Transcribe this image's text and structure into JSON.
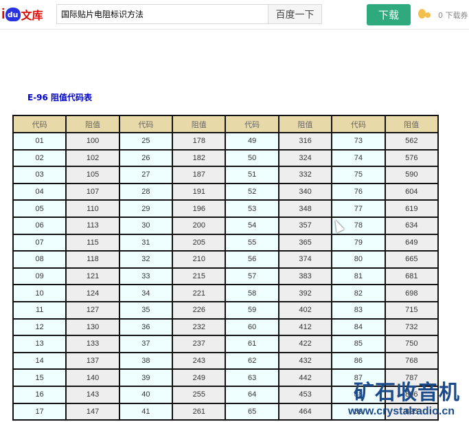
{
  "header": {
    "logo": "文库",
    "logo_du": "du",
    "logo_i": "i",
    "search_value": "国际贴片电阻标识方法",
    "search_button": "百度一下",
    "download_button": "下载",
    "vouchers": "0 下载券"
  },
  "title": "E-96 阻值代码表",
  "table": {
    "headers": [
      "代码",
      "阻值",
      "代码",
      "阻值",
      "代码",
      "阻值",
      "代码",
      "阻值"
    ],
    "rows": [
      [
        "01",
        "100",
        "25",
        "178",
        "49",
        "316",
        "73",
        "562"
      ],
      [
        "02",
        "102",
        "26",
        "182",
        "50",
        "324",
        "74",
        "576"
      ],
      [
        "03",
        "105",
        "27",
        "187",
        "51",
        "332",
        "75",
        "590"
      ],
      [
        "04",
        "107",
        "28",
        "191",
        "52",
        "340",
        "76",
        "604"
      ],
      [
        "05",
        "110",
        "29",
        "196",
        "53",
        "348",
        "77",
        "619"
      ],
      [
        "06",
        "113",
        "30",
        "200",
        "54",
        "357",
        "78",
        "634"
      ],
      [
        "07",
        "115",
        "31",
        "205",
        "55",
        "365",
        "79",
        "649"
      ],
      [
        "08",
        "118",
        "32",
        "210",
        "56",
        "374",
        "80",
        "665"
      ],
      [
        "09",
        "121",
        "33",
        "215",
        "57",
        "383",
        "81",
        "681"
      ],
      [
        "10",
        "124",
        "34",
        "221",
        "58",
        "392",
        "82",
        "698"
      ],
      [
        "11",
        "127",
        "35",
        "226",
        "59",
        "402",
        "83",
        "715"
      ],
      [
        "12",
        "130",
        "36",
        "232",
        "60",
        "412",
        "84",
        "732"
      ],
      [
        "13",
        "133",
        "37",
        "237",
        "61",
        "422",
        "85",
        "750"
      ],
      [
        "14",
        "137",
        "38",
        "243",
        "62",
        "432",
        "86",
        "768"
      ],
      [
        "15",
        "140",
        "39",
        "249",
        "63",
        "442",
        "87",
        "787"
      ],
      [
        "16",
        "143",
        "40",
        "255",
        "64",
        "453",
        "88",
        "806"
      ],
      [
        "17",
        "147",
        "41",
        "261",
        "65",
        "464",
        "89",
        "825"
      ]
    ]
  },
  "watermark": {
    "name": "矿石收音机",
    "url": "www.crystalradio.cn"
  }
}
